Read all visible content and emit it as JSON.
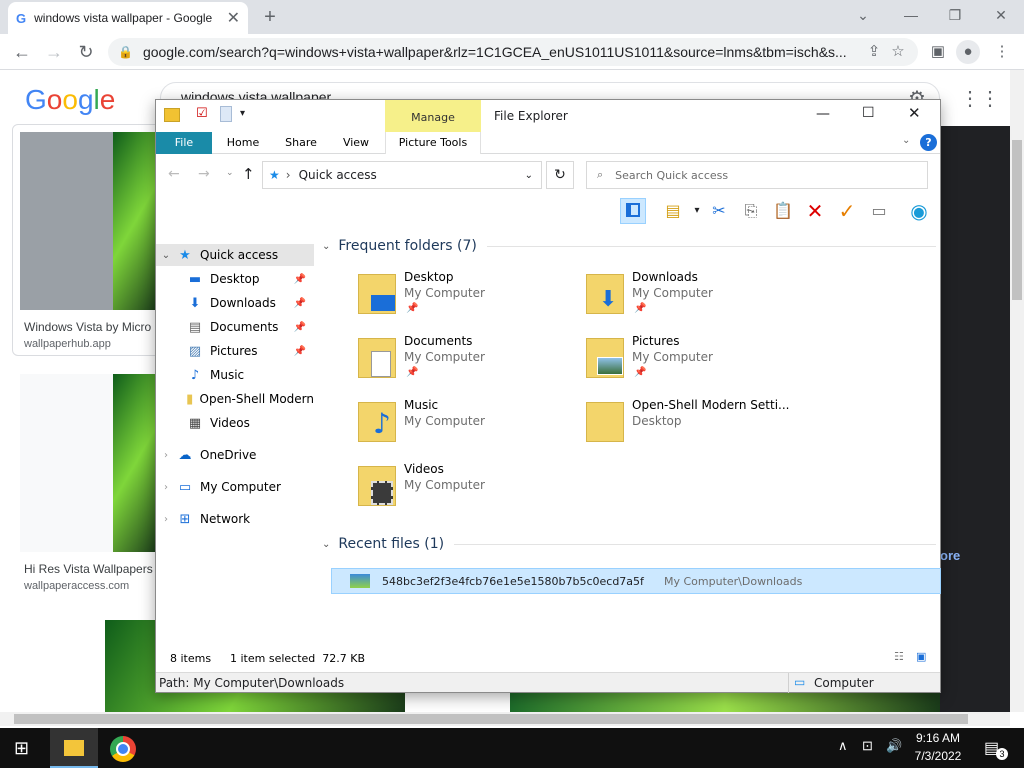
{
  "browser": {
    "tab_title": "windows vista wallpaper - Google",
    "tab_favicon": "G",
    "url": "google.com/search?q=windows+vista+wallpaper&rlz=1C1GCEA_enUS1011US1011&source=lnms&tbm=isch&s..."
  },
  "google": {
    "search_text": "windows vista wallpaper",
    "results": [
      {
        "title": "Windows Vista by Micro",
        "source": "wallpaperhub.app"
      },
      {
        "title": "Hi Res Vista Wallpapers",
        "source": "wallpaperaccess.com"
      }
    ],
    "more_label": "ore"
  },
  "explorer": {
    "title": "File Explorer",
    "manage_label": "Manage",
    "tabs": [
      "File",
      "Home",
      "Share",
      "View",
      "Picture Tools"
    ],
    "address": "Quick access",
    "search_placeholder": "Search Quick access",
    "nav": [
      {
        "label": "Quick access",
        "icon": "star-icon"
      },
      {
        "label": "Desktop",
        "icon": "desktop-icon"
      },
      {
        "label": "Downloads",
        "icon": "download-icon"
      },
      {
        "label": "Documents",
        "icon": "document-icon"
      },
      {
        "label": "Pictures",
        "icon": "picture-icon"
      },
      {
        "label": "Music",
        "icon": "music-icon"
      },
      {
        "label": "Open-Shell Modern",
        "icon": "folder-icon"
      },
      {
        "label": "Videos",
        "icon": "video-icon"
      },
      {
        "label": "OneDrive",
        "icon": "cloud-icon"
      },
      {
        "label": "My Computer",
        "icon": "computer-icon"
      },
      {
        "label": "Network",
        "icon": "network-icon"
      }
    ],
    "frequent_header": "Frequent folders (7)",
    "frequent": [
      {
        "name": "Desktop",
        "location": "My Computer"
      },
      {
        "name": "Downloads",
        "location": "My Computer"
      },
      {
        "name": "Documents",
        "location": "My Computer"
      },
      {
        "name": "Pictures",
        "location": "My Computer"
      },
      {
        "name": "Music",
        "location": "My Computer"
      },
      {
        "name": "Open-Shell Modern Setti...",
        "location": "Desktop"
      },
      {
        "name": "Videos",
        "location": "My Computer"
      }
    ],
    "recent_header": "Recent files (1)",
    "recent_file": {
      "name": "548bc3ef2f3e4fcb76e1e5e1580b7b5c0ecd7a5f",
      "path": "My Computer\\Downloads"
    },
    "status_items": "8 items",
    "status_selected": "1 item selected  72.7 KB",
    "path_label": "Path: My Computer\\Downloads",
    "computer_label": "Computer"
  },
  "taskbar": {
    "time": "9:16 AM",
    "date": "7/3/2022",
    "notif_count": "3"
  }
}
